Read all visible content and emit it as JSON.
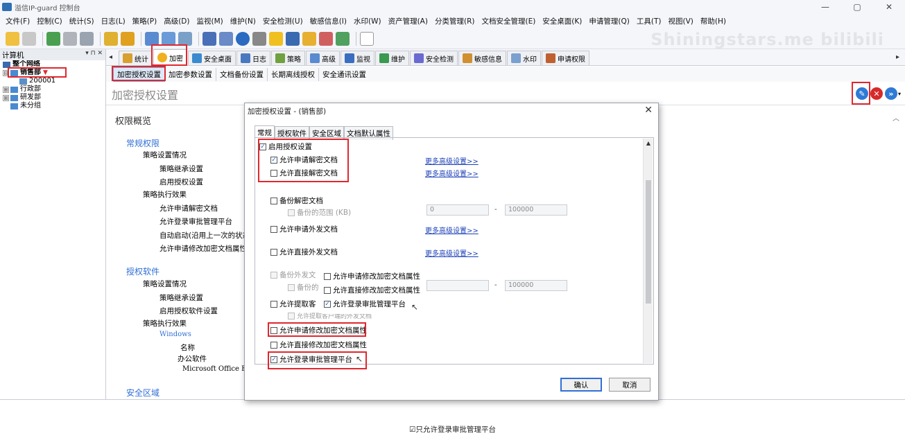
{
  "titlebar": {
    "title": "溢信IP-guard 控制台",
    "min": "—",
    "max": "▢",
    "close": "✕"
  },
  "menu": [
    "文件(F)",
    "控制(C)",
    "统计(S)",
    "日志(L)",
    "策略(P)",
    "高级(D)",
    "监视(M)",
    "维护(N)",
    "安全检测(U)",
    "敏感信息(I)",
    "水印(W)",
    "资产管理(A)",
    "分类管理(R)",
    "文档安全管理(E)",
    "安全桌面(K)",
    "申请管理(Q)",
    "工具(T)",
    "视图(V)",
    "帮助(H)"
  ],
  "watermark": "Shiningstars.me  bilibili",
  "left_panel": {
    "header": "计算机",
    "header_ctrls": "▾ ⊓ ✕",
    "tree": [
      {
        "label": "整个网络",
        "level": 0
      },
      {
        "label": "销售部",
        "level": 0,
        "expander": "⊟"
      },
      {
        "label": "200001",
        "level": 2
      },
      {
        "label": "行政部",
        "level": 0,
        "expander": "⊞"
      },
      {
        "label": "研发部",
        "level": 0,
        "expander": "⊞"
      },
      {
        "label": "未分组",
        "level": 1
      }
    ]
  },
  "main_tabs": [
    {
      "label": "统计",
      "color": "#d8a030"
    },
    {
      "label": "加密",
      "color": "#f0b020"
    },
    {
      "label": "安全桌面",
      "color": "#3a8ad0"
    },
    {
      "label": "日志",
      "color": "#4a78c0"
    },
    {
      "label": "策略",
      "color": "#70a040"
    },
    {
      "label": "高级",
      "color": "#5a8ad0"
    },
    {
      "label": "监视",
      "color": "#3a6ec0"
    },
    {
      "label": "维护",
      "color": "#3a9a50"
    },
    {
      "label": "安全检测",
      "color": "#6a6ad0"
    },
    {
      "label": "敏感信息",
      "color": "#d09030"
    },
    {
      "label": "水印",
      "color": "#7aa0d0"
    },
    {
      "label": "申请权限",
      "color": "#c06030"
    }
  ],
  "sub_tabs": [
    "加密授权设置",
    "加密参数设置",
    "文档备份设置",
    "长期离线授权",
    "安全通讯设置"
  ],
  "page_title": "加密授权设置",
  "overview": {
    "title": "权限概览",
    "lines": [
      {
        "text": "常规权限",
        "kind": "sec"
      },
      {
        "text": "策略设置情况",
        "kind": "l1"
      },
      {
        "text": "策略继承设置",
        "kind": "l2"
      },
      {
        "text": "启用授权设置",
        "kind": "l2"
      },
      {
        "text": "策略执行效果",
        "kind": "l1"
      },
      {
        "text": "允许申请解密文档",
        "kind": "l2"
      },
      {
        "text": "允许登录审批管理平台",
        "kind": "l2"
      },
      {
        "text": "自动启动(沿用上一次的状态",
        "kind": "l2"
      },
      {
        "text": "允许申请修改加密文档属性",
        "kind": "l2"
      },
      {
        "text": "授权软件",
        "kind": "sec"
      },
      {
        "text": "策略设置情况",
        "kind": "l1"
      },
      {
        "text": "策略继承设置",
        "kind": "l2"
      },
      {
        "text": "启用授权软件设置",
        "kind": "l2"
      },
      {
        "text": "策略执行效果",
        "kind": "l1"
      },
      {
        "text": "Windows",
        "kind": "win"
      },
      {
        "text": "名称",
        "kind": "l3"
      },
      {
        "text": "办公软件",
        "kind": "l4"
      },
      {
        "text": "Microsoft Office Exc",
        "kind": "l5"
      },
      {
        "text": "安全区域",
        "kind": "sec"
      }
    ]
  },
  "dialog": {
    "title": "加密授权设置 - (销售部)",
    "close": "✕",
    "tabs": [
      "常规",
      "授权软件",
      "安全区域",
      "文档默认属性"
    ],
    "items": {
      "enable_auth": {
        "label": "启用授权设置",
        "checked": true
      },
      "allow_apply_decrypt": {
        "label": "允许申请解密文档",
        "checked": true
      },
      "allow_direct_decrypt": {
        "label": "允许直接解密文档",
        "checked": false
      },
      "backup_decrypt": {
        "label": "备份解密文档",
        "checked": false
      },
      "backup_range": {
        "label": "备份的范围 (KB)",
        "checked": false
      },
      "allow_apply_send": {
        "label": "允许申请外发文档",
        "checked": false
      },
      "allow_direct_send": {
        "label": "允许直接外发文档",
        "checked": false
      },
      "backup_send": {
        "label": "备份外发文",
        "checked": false
      },
      "backup_send_sub": {
        "label": "备份的",
        "checked": false
      },
      "allow_extract": {
        "label": "允许提取客",
        "checked": false
      },
      "allow_extract_sub": {
        "label": "允许提取客户端的外发文档",
        "checked": false
      },
      "popup_apply_modify": {
        "label": "允许申请修改加密文档属性",
        "checked": false
      },
      "popup_direct_modify": {
        "label": "允许直接修改加密文档属性",
        "checked": false
      },
      "popup_login": {
        "label": "允许登录审批管理平台",
        "checked": true
      },
      "allow_apply_modify": {
        "label": "允许申请修改加密文档属性",
        "checked": false
      },
      "allow_direct_modify": {
        "label": "允许直接修改加密文档属性",
        "checked": false
      },
      "allow_login": {
        "label": "允许登录审批管理平台",
        "checked": true
      }
    },
    "more_link": "更多高级设置>>",
    "range1": {
      "from": "0",
      "to": "100000",
      "sep": "-"
    },
    "range2": {
      "to": "100000",
      "sep": "-"
    },
    "ok": "确认",
    "cancel": "取消"
  },
  "caption": "☑只允许登录审批管理平台"
}
